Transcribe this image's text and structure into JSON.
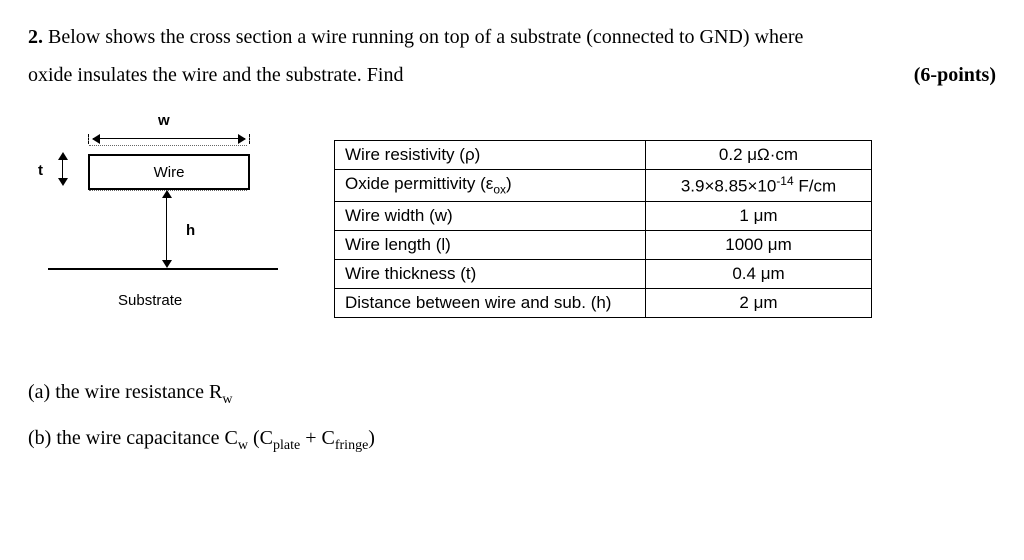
{
  "question": {
    "number": "2.",
    "text_part1": "Below shows the cross section a wire running on top of a substrate (connected to GND) where",
    "text_part2": "oxide insulates the wire and the substrate. Find",
    "points": "(6-points)"
  },
  "diagram": {
    "w_label": "w",
    "wire_label": "Wire",
    "t_label": "t",
    "h_label": "h",
    "substrate_label": "Substrate"
  },
  "table": {
    "rows": [
      {
        "param": "Wire resistivity (ρ)",
        "value": "0.2 μΩ·cm"
      },
      {
        "param": "Oxide permittivity (ε",
        "param_sub": "ox",
        "param_tail": ")",
        "value": "3.9×8.85×10",
        "value_sup": "-14",
        "value_tail": "  F/cm"
      },
      {
        "param": "Wire width (w)",
        "value": "1 μm"
      },
      {
        "param": "Wire length (l)",
        "value": "1000 μm"
      },
      {
        "param": "Wire thickness (t)",
        "value": "0.4 μm"
      },
      {
        "param": "Distance between wire and sub. (h)",
        "value": "2 μm"
      }
    ]
  },
  "parts": {
    "a_prefix": "(a) the wire resistance R",
    "a_sub": "w",
    "b_prefix": "(b) the wire capacitance C",
    "b_sub": "w",
    "b_mid": " (C",
    "b_sub2": "plate",
    "b_mid2": " + C",
    "b_sub3": "fringe",
    "b_tail": ")"
  }
}
